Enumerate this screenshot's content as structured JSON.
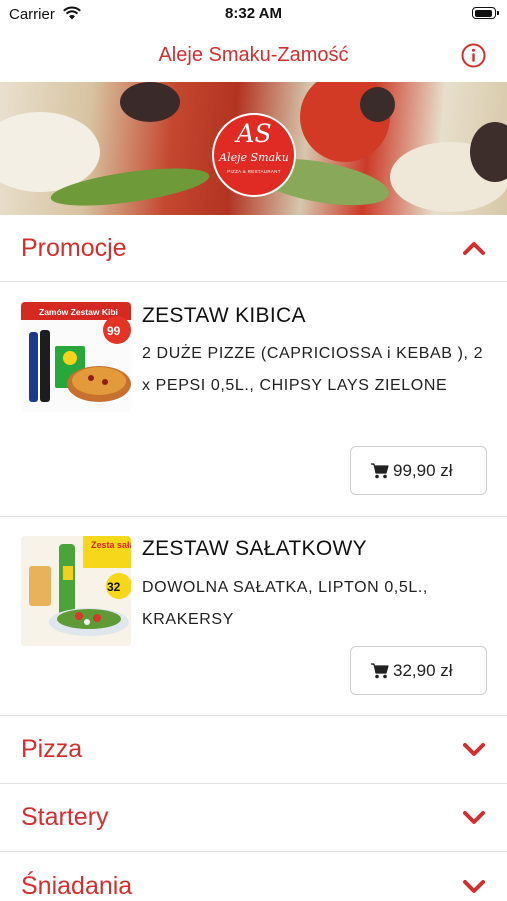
{
  "status_bar": {
    "carrier": "Carrier",
    "time": "8:32 AM"
  },
  "header": {
    "title": "Aleje Smaku-Zamość",
    "info_icon": "info-circle-icon"
  },
  "banner": {
    "logo": {
      "monogram": "AS",
      "script": "Aleje Smaku",
      "tagline": "PIZZA & RESTAURANT"
    }
  },
  "sections": [
    {
      "label": "Promocje",
      "expanded": true
    },
    {
      "label": "Pizza",
      "expanded": false
    },
    {
      "label": "Startery",
      "expanded": false
    },
    {
      "label": "Śniadania",
      "expanded": false
    }
  ],
  "products": [
    {
      "name": "ZESTAW KIBICA",
      "description": "2 DUŻE PIZZE (CAPRICIOSSA i KEBAB ), 2 x PEPSI 0,5L., CHIPSY LAYS ZIELONE",
      "price": "99,90 zł",
      "image": {
        "caption": "Zamów Zestaw Kibi",
        "badge": "99"
      }
    },
    {
      "name": "ZESTAW SAŁATKOWY",
      "description": "DOWOLNA SAŁATKA, LIPTON 0,5L., KRAKERSY",
      "price": "32,90 zł",
      "image": {
        "caption": "Zesta sałatkow",
        "badge": "32"
      }
    }
  ],
  "colors": {
    "accent": "#d32f2f",
    "divider": "#e1e1e1"
  }
}
